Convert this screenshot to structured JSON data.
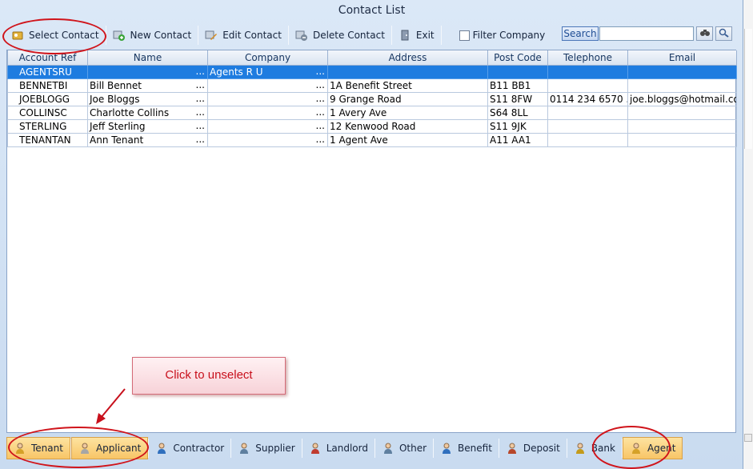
{
  "window": {
    "title": "Contact List"
  },
  "toolbar": {
    "select_contact": "Select Contact",
    "new_contact": "New Contact",
    "edit_contact": "Edit Contact",
    "delete_contact": "Delete Contact",
    "exit": "Exit",
    "filter_company": "Filter Company",
    "search_label": "Search",
    "search_value": ""
  },
  "table": {
    "columns": [
      "Account Ref",
      "Name",
      "Company",
      "Address",
      "Post Code",
      "Telephone",
      "Email"
    ],
    "rows": [
      {
        "ref": "AGENTSRU",
        "name": "",
        "company": "Agents R U",
        "address": "",
        "postcode": "",
        "telephone": "",
        "email": "",
        "selected": true
      },
      {
        "ref": "BENNETBI",
        "name": "Bill Bennet",
        "company": "",
        "address": "1A Benefit Street",
        "postcode": "B11 BB1",
        "telephone": "",
        "email": ""
      },
      {
        "ref": "JOEBLOGG",
        "name": "Joe Bloggs",
        "company": "",
        "address": "9 Grange Road",
        "postcode": "S11 8FW",
        "telephone": "0114 234 6570 ...",
        "email": "joe.bloggs@hotmail.co..."
      },
      {
        "ref": "COLLINSC",
        "name": "Charlotte Collins",
        "company": "",
        "address": "1 Avery Ave",
        "postcode": "S64 8LL",
        "telephone": "",
        "email": ""
      },
      {
        "ref": "STERLING",
        "name": "Jeff Sterling",
        "company": "",
        "address": "12 Kenwood Road",
        "postcode": "S11 9JK",
        "telephone": "",
        "email": ""
      },
      {
        "ref": "TENANTAN",
        "name": "Ann Tenant",
        "company": "",
        "address": "1 Agent Ave",
        "postcode": "A11 AA1",
        "telephone": "",
        "email": ""
      }
    ],
    "ellipsis": "..."
  },
  "tabs": [
    {
      "label": "Tenant",
      "active": true
    },
    {
      "label": "Applicant",
      "active": true
    },
    {
      "label": "Contractor",
      "active": false
    },
    {
      "label": "Supplier",
      "active": false
    },
    {
      "label": "Landlord",
      "active": false
    },
    {
      "label": "Other",
      "active": false
    },
    {
      "label": "Benefit",
      "active": false
    },
    {
      "label": "Deposit",
      "active": false
    },
    {
      "label": "Bank",
      "active": false
    },
    {
      "label": "Agent",
      "active": true
    }
  ],
  "annotation": {
    "callout_text": "Click to unselect"
  },
  "colors": {
    "annotation_red": "#d0141b",
    "selection_blue": "#1e7ce0",
    "active_tab": "#f8c567"
  }
}
